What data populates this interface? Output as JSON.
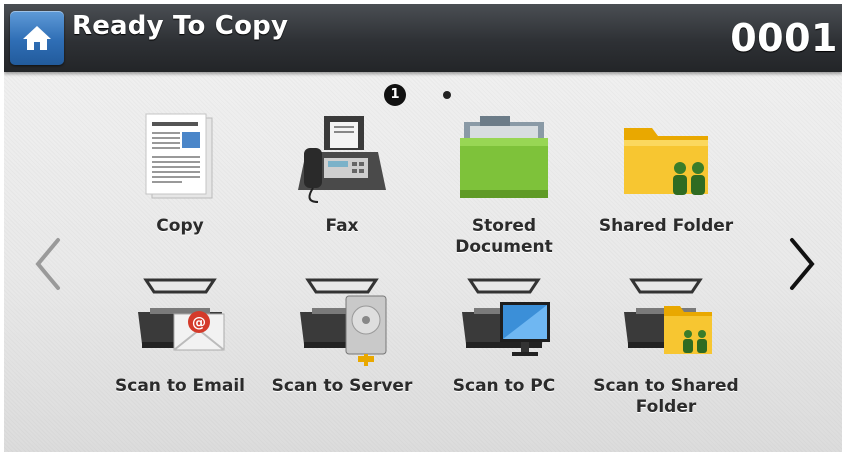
{
  "header": {
    "title": "Ready To Copy",
    "counter": "0001"
  },
  "pager": {
    "current": "1"
  },
  "apps": [
    {
      "label": "Copy"
    },
    {
      "label": "Fax"
    },
    {
      "label": "Stored\nDocument"
    },
    {
      "label": "Shared Folder"
    },
    {
      "label": "Scan to Email"
    },
    {
      "label": "Scan to Server"
    },
    {
      "label": "Scan to PC"
    },
    {
      "label": "Scan to Shared\nFolder"
    }
  ],
  "icons": {
    "home": "home-icon",
    "prev": "chevron-left-icon",
    "next": "chevron-right-icon",
    "copy": "document-icon",
    "fax": "fax-machine-icon",
    "stored": "green-folder-icon",
    "shared": "shared-folder-icon",
    "email": "scanner-email-icon",
    "server": "scanner-server-icon",
    "pc": "scanner-pc-icon",
    "scan_shared": "scanner-shared-folder-icon"
  },
  "colors": {
    "header": "#2e3135",
    "home_button": "#2f6eb5",
    "background": "#ebebeb"
  }
}
